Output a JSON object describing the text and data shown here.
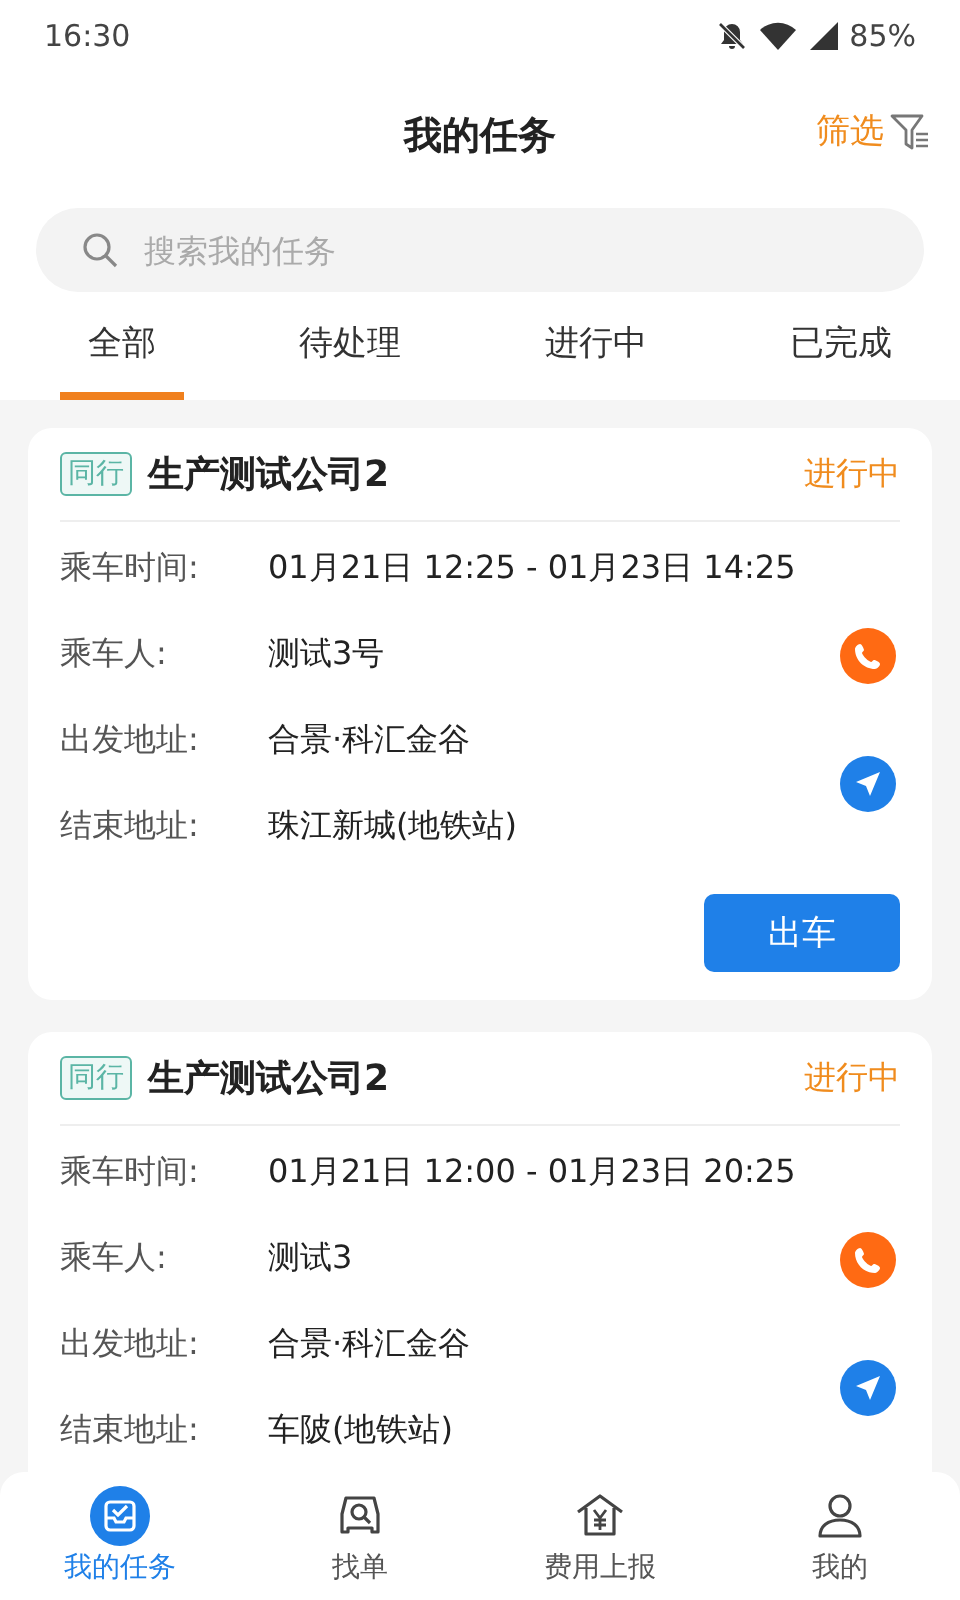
{
  "status_bar": {
    "time": "16:30",
    "battery": "85%"
  },
  "header": {
    "title": "我的任务",
    "filter": "筛选"
  },
  "search": {
    "placeholder": "搜索我的任务"
  },
  "tabs": [
    {
      "label": "全部",
      "selected": true
    },
    {
      "label": "待处理",
      "selected": false
    },
    {
      "label": "进行中",
      "selected": false
    },
    {
      "label": "已完成",
      "selected": false
    }
  ],
  "tasks": [
    {
      "tag": "同行",
      "company": "生产测试公司2",
      "status": "进行中",
      "time_label": "乘车时间:",
      "time": "01月21日 12:25 - 01月23日 14:25",
      "passenger_label": "乘车人:",
      "passenger": "测试3号",
      "start_label": "出发地址:",
      "start": "合景·科汇金谷",
      "end_label": "结束地址:",
      "end": "珠江新城(地铁站)",
      "action": "出车"
    },
    {
      "tag": "同行",
      "company": "生产测试公司2",
      "status": "进行中",
      "time_label": "乘车时间:",
      "time": "01月21日 12:00 - 01月23日 20:25",
      "passenger_label": "乘车人:",
      "passenger": "测试3",
      "start_label": "出发地址:",
      "start": "合景·科汇金谷",
      "end_label": "结束地址:",
      "end": "车陂(地铁站)"
    }
  ],
  "bottom_nav": [
    {
      "label": "我的任务",
      "selected": true,
      "kind": "tasks"
    },
    {
      "label": "找单",
      "selected": false,
      "kind": "find"
    },
    {
      "label": "费用上报",
      "selected": false,
      "kind": "expense"
    },
    {
      "label": "我的",
      "selected": false,
      "kind": "profile"
    }
  ]
}
